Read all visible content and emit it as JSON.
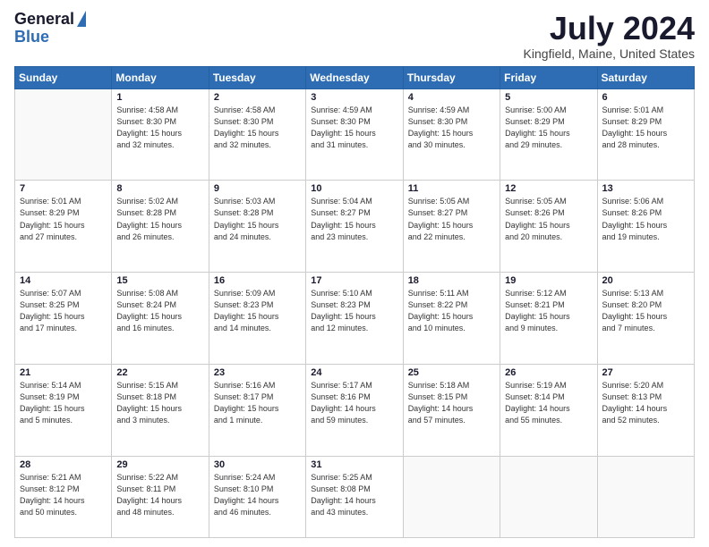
{
  "header": {
    "logo_general": "General",
    "logo_blue": "Blue",
    "month_title": "July 2024",
    "location": "Kingfield, Maine, United States"
  },
  "days_of_week": [
    "Sunday",
    "Monday",
    "Tuesday",
    "Wednesday",
    "Thursday",
    "Friday",
    "Saturday"
  ],
  "weeks": [
    [
      {
        "day": "",
        "info": ""
      },
      {
        "day": "1",
        "info": "Sunrise: 4:58 AM\nSunset: 8:30 PM\nDaylight: 15 hours\nand 32 minutes."
      },
      {
        "day": "2",
        "info": "Sunrise: 4:58 AM\nSunset: 8:30 PM\nDaylight: 15 hours\nand 32 minutes."
      },
      {
        "day": "3",
        "info": "Sunrise: 4:59 AM\nSunset: 8:30 PM\nDaylight: 15 hours\nand 31 minutes."
      },
      {
        "day": "4",
        "info": "Sunrise: 4:59 AM\nSunset: 8:30 PM\nDaylight: 15 hours\nand 30 minutes."
      },
      {
        "day": "5",
        "info": "Sunrise: 5:00 AM\nSunset: 8:29 PM\nDaylight: 15 hours\nand 29 minutes."
      },
      {
        "day": "6",
        "info": "Sunrise: 5:01 AM\nSunset: 8:29 PM\nDaylight: 15 hours\nand 28 minutes."
      }
    ],
    [
      {
        "day": "7",
        "info": "Sunrise: 5:01 AM\nSunset: 8:29 PM\nDaylight: 15 hours\nand 27 minutes."
      },
      {
        "day": "8",
        "info": "Sunrise: 5:02 AM\nSunset: 8:28 PM\nDaylight: 15 hours\nand 26 minutes."
      },
      {
        "day": "9",
        "info": "Sunrise: 5:03 AM\nSunset: 8:28 PM\nDaylight: 15 hours\nand 24 minutes."
      },
      {
        "day": "10",
        "info": "Sunrise: 5:04 AM\nSunset: 8:27 PM\nDaylight: 15 hours\nand 23 minutes."
      },
      {
        "day": "11",
        "info": "Sunrise: 5:05 AM\nSunset: 8:27 PM\nDaylight: 15 hours\nand 22 minutes."
      },
      {
        "day": "12",
        "info": "Sunrise: 5:05 AM\nSunset: 8:26 PM\nDaylight: 15 hours\nand 20 minutes."
      },
      {
        "day": "13",
        "info": "Sunrise: 5:06 AM\nSunset: 8:26 PM\nDaylight: 15 hours\nand 19 minutes."
      }
    ],
    [
      {
        "day": "14",
        "info": "Sunrise: 5:07 AM\nSunset: 8:25 PM\nDaylight: 15 hours\nand 17 minutes."
      },
      {
        "day": "15",
        "info": "Sunrise: 5:08 AM\nSunset: 8:24 PM\nDaylight: 15 hours\nand 16 minutes."
      },
      {
        "day": "16",
        "info": "Sunrise: 5:09 AM\nSunset: 8:23 PM\nDaylight: 15 hours\nand 14 minutes."
      },
      {
        "day": "17",
        "info": "Sunrise: 5:10 AM\nSunset: 8:23 PM\nDaylight: 15 hours\nand 12 minutes."
      },
      {
        "day": "18",
        "info": "Sunrise: 5:11 AM\nSunset: 8:22 PM\nDaylight: 15 hours\nand 10 minutes."
      },
      {
        "day": "19",
        "info": "Sunrise: 5:12 AM\nSunset: 8:21 PM\nDaylight: 15 hours\nand 9 minutes."
      },
      {
        "day": "20",
        "info": "Sunrise: 5:13 AM\nSunset: 8:20 PM\nDaylight: 15 hours\nand 7 minutes."
      }
    ],
    [
      {
        "day": "21",
        "info": "Sunrise: 5:14 AM\nSunset: 8:19 PM\nDaylight: 15 hours\nand 5 minutes."
      },
      {
        "day": "22",
        "info": "Sunrise: 5:15 AM\nSunset: 8:18 PM\nDaylight: 15 hours\nand 3 minutes."
      },
      {
        "day": "23",
        "info": "Sunrise: 5:16 AM\nSunset: 8:17 PM\nDaylight: 15 hours\nand 1 minute."
      },
      {
        "day": "24",
        "info": "Sunrise: 5:17 AM\nSunset: 8:16 PM\nDaylight: 14 hours\nand 59 minutes."
      },
      {
        "day": "25",
        "info": "Sunrise: 5:18 AM\nSunset: 8:15 PM\nDaylight: 14 hours\nand 57 minutes."
      },
      {
        "day": "26",
        "info": "Sunrise: 5:19 AM\nSunset: 8:14 PM\nDaylight: 14 hours\nand 55 minutes."
      },
      {
        "day": "27",
        "info": "Sunrise: 5:20 AM\nSunset: 8:13 PM\nDaylight: 14 hours\nand 52 minutes."
      }
    ],
    [
      {
        "day": "28",
        "info": "Sunrise: 5:21 AM\nSunset: 8:12 PM\nDaylight: 14 hours\nand 50 minutes."
      },
      {
        "day": "29",
        "info": "Sunrise: 5:22 AM\nSunset: 8:11 PM\nDaylight: 14 hours\nand 48 minutes."
      },
      {
        "day": "30",
        "info": "Sunrise: 5:24 AM\nSunset: 8:10 PM\nDaylight: 14 hours\nand 46 minutes."
      },
      {
        "day": "31",
        "info": "Sunrise: 5:25 AM\nSunset: 8:08 PM\nDaylight: 14 hours\nand 43 minutes."
      },
      {
        "day": "",
        "info": ""
      },
      {
        "day": "",
        "info": ""
      },
      {
        "day": "",
        "info": ""
      }
    ]
  ]
}
